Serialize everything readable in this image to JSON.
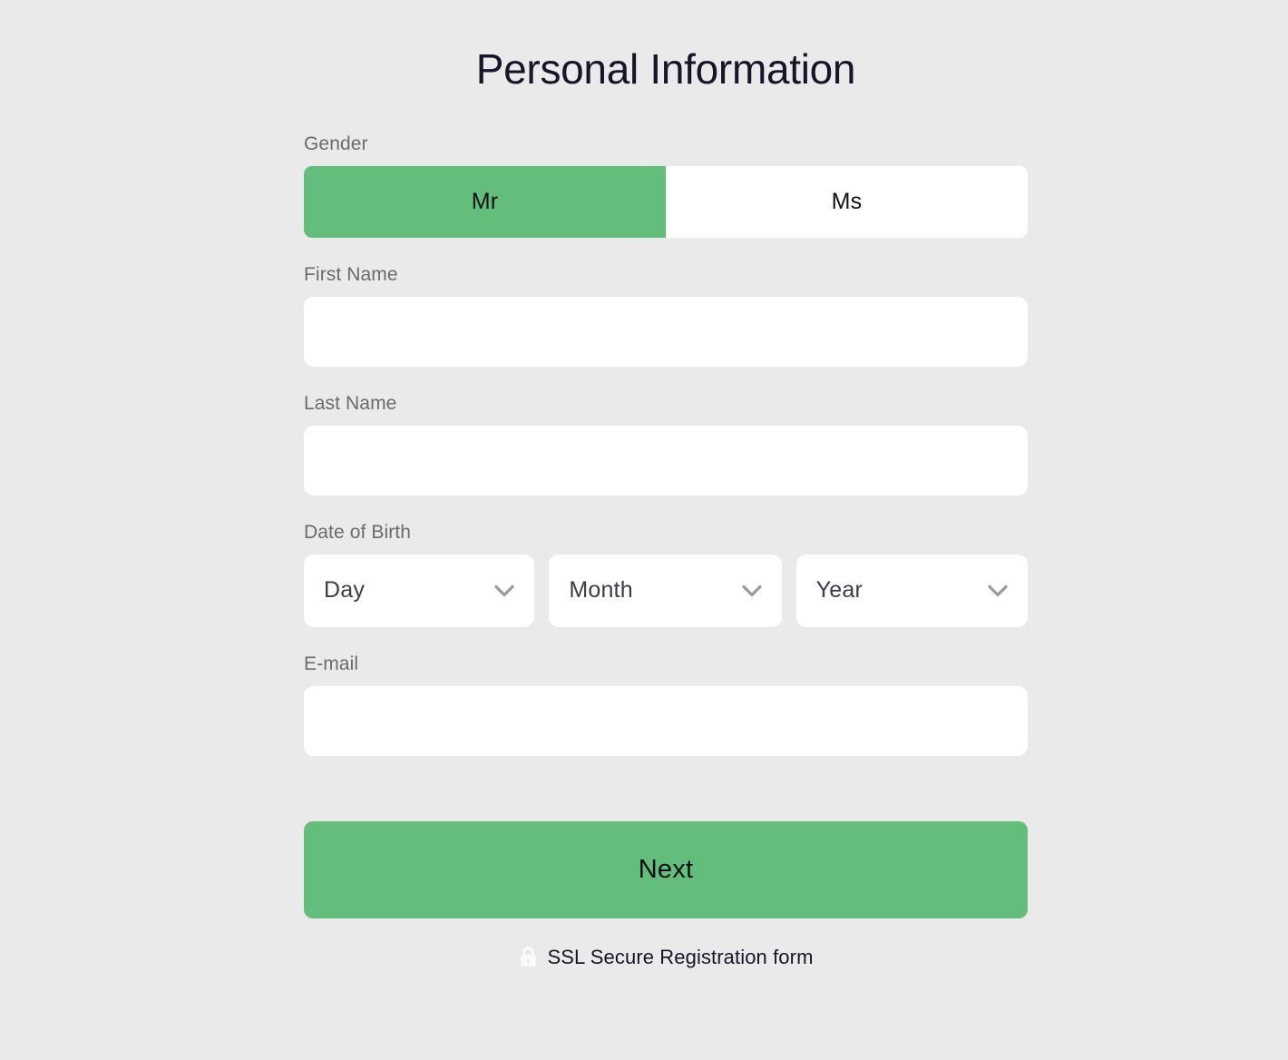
{
  "page": {
    "title": "Personal Information",
    "background_color": "#eaeaea",
    "accent_color": "#63bd7b"
  },
  "form": {
    "gender": {
      "label": "Gender",
      "options": [
        {
          "label": "Mr",
          "selected": true
        },
        {
          "label": "Ms",
          "selected": false
        }
      ]
    },
    "first_name": {
      "label": "First Name",
      "value": "",
      "placeholder": ""
    },
    "last_name": {
      "label": "Last Name",
      "value": "",
      "placeholder": ""
    },
    "date_of_birth": {
      "label": "Date of Birth",
      "selects": [
        {
          "name": "day",
          "value": "Day",
          "icon": "chevron-down-icon"
        },
        {
          "name": "month",
          "value": "Month",
          "icon": "chevron-down-icon"
        },
        {
          "name": "year",
          "value": "Year",
          "icon": "chevron-down-icon"
        }
      ]
    },
    "email": {
      "label": "E-mail",
      "value": "",
      "placeholder": ""
    },
    "submit": {
      "label": "Next"
    }
  },
  "footer": {
    "icon": "lock-icon",
    "text": "SSL Secure Registration form"
  }
}
